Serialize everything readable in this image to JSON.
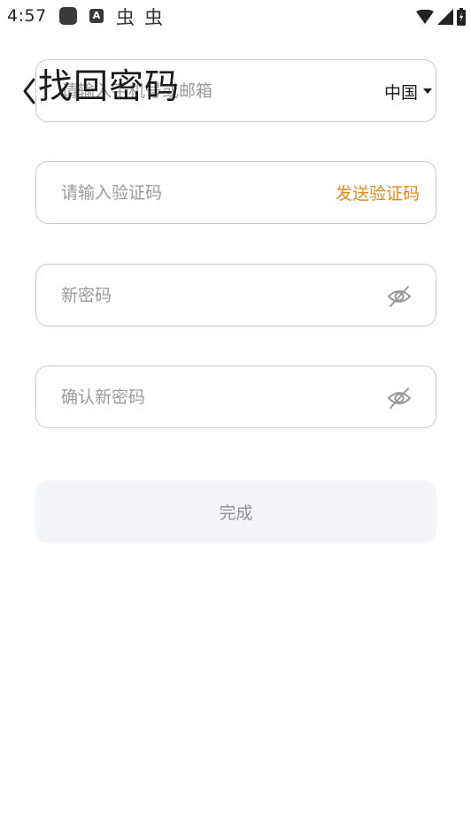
{
  "status_bar": {
    "time": "4:57",
    "app_icon_letter": "A",
    "bug_glyph": "虫"
  },
  "header": {
    "title": "找回密码",
    "back_icon": "chevron-left-icon"
  },
  "form": {
    "account_field": {
      "placeholder": "请输入手机号或邮箱",
      "country_label": "中国"
    },
    "code_field": {
      "placeholder": "请输入验证码",
      "send_code_label": "发送验证码"
    },
    "new_password_field": {
      "placeholder": "新密码",
      "toggle_icon": "eye-off-icon"
    },
    "confirm_password_field": {
      "placeholder": "确认新密码",
      "toggle_icon": "eye-off-icon"
    },
    "submit_label": "完成"
  },
  "colors": {
    "accent": "#e88a1a",
    "field_border": "#c9c9c9",
    "button_bg": "#f3f5f9",
    "button_text": "#8f8f8f",
    "placeholder": "#9a9a9a"
  }
}
